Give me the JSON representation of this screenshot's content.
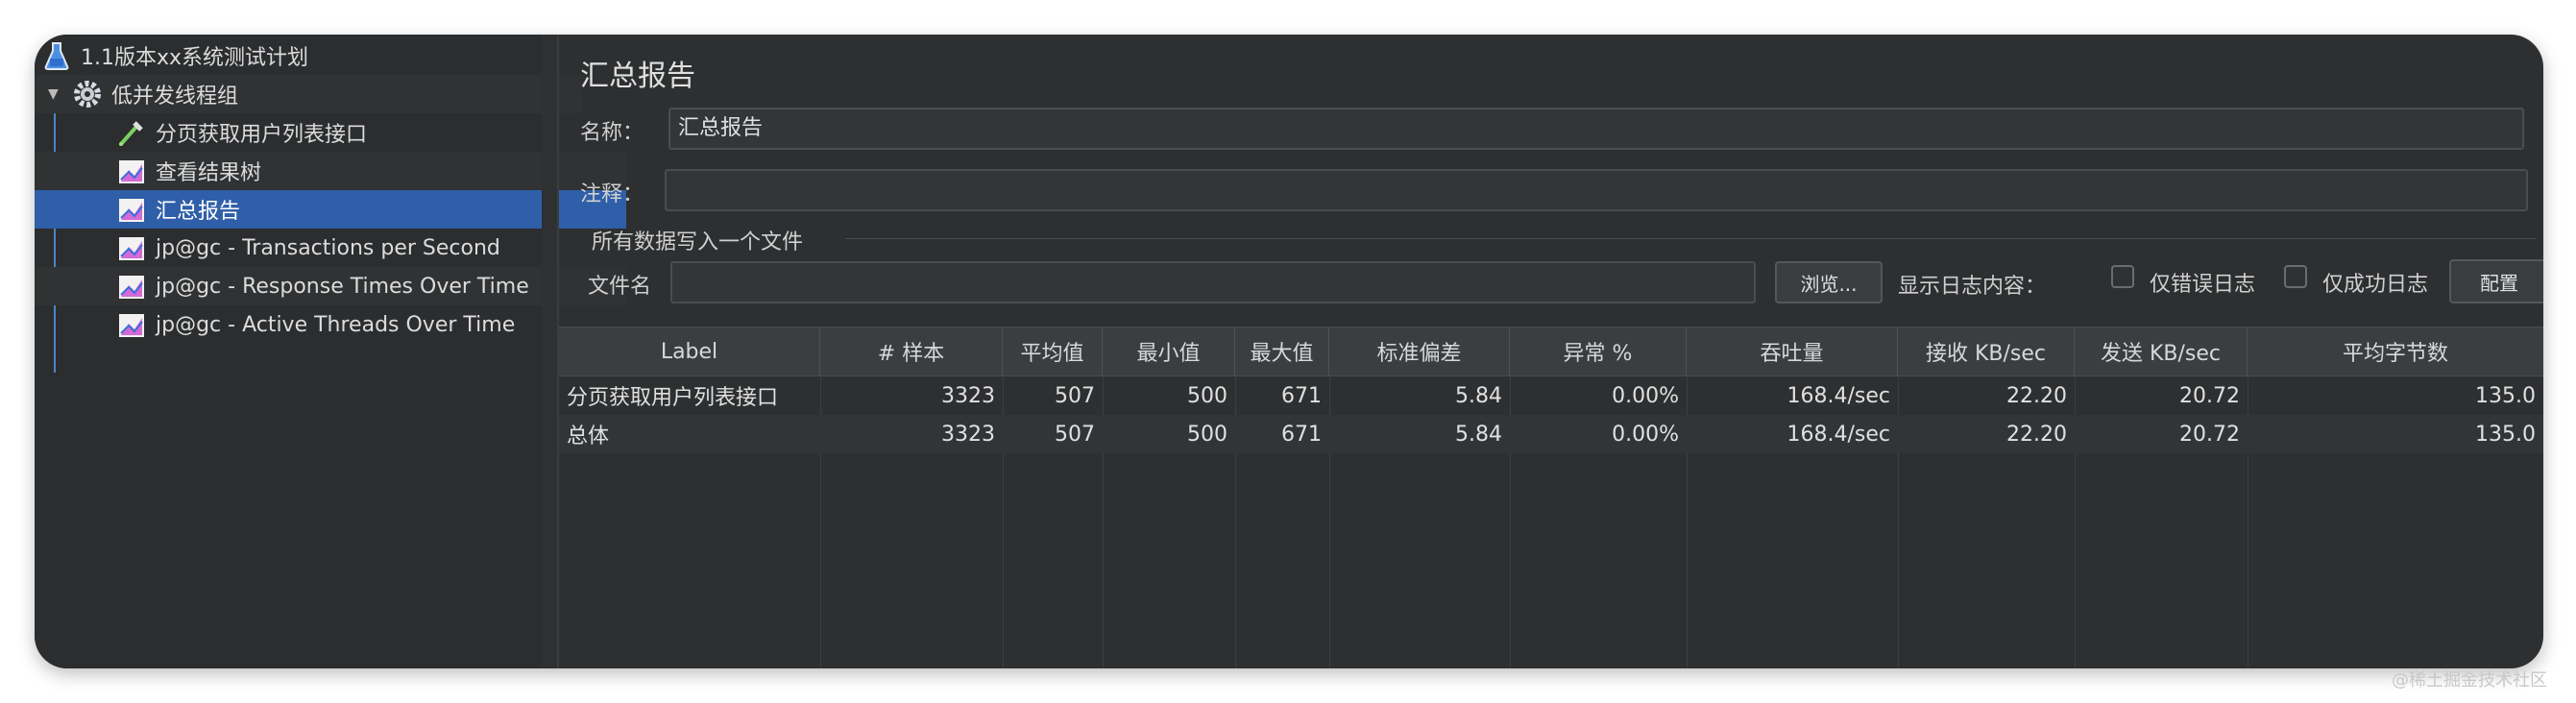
{
  "tree": {
    "items": [
      {
        "label": "1.1版本xx系统测试计划",
        "icon": "flask-icon"
      },
      {
        "label": "低并发线程组",
        "icon": "gear-icon"
      },
      {
        "label": "分页获取用户列表接口",
        "icon": "pipette-icon"
      },
      {
        "label": "查看结果树",
        "icon": "chart-icon"
      },
      {
        "label": "汇总报告",
        "icon": "chart-icon"
      },
      {
        "label": "jp@gc - Transactions per Second",
        "icon": "chart-icon"
      },
      {
        "label": "jp@gc - Response Times Over Time",
        "icon": "chart-icon"
      },
      {
        "label": "jp@gc - Active Threads Over Time",
        "icon": "chart-icon"
      }
    ]
  },
  "panel": {
    "title": "汇总报告",
    "name_label": "名称：",
    "name_value": "汇总报告",
    "comment_label": "注释：",
    "comment_value": "",
    "group_title": "所有数据写入一个文件",
    "filename_label": "文件名",
    "filename_value": "",
    "browse_label": "浏览...",
    "log_label": "显示日志内容：",
    "errors_only_label": "仅错误日志",
    "success_only_label": "仅成功日志",
    "config_label": "配置"
  },
  "table": {
    "columns": [
      "Label",
      "# 样本",
      "平均值",
      "最小值",
      "最大值",
      "标准偏差",
      "异常 %",
      "吞吐量",
      "接收 KB/sec",
      "发送 KB/sec",
      "平均字节数"
    ],
    "rows": [
      [
        "分页获取用户列表接口",
        "3323",
        "507",
        "500",
        "671",
        "5.84",
        "0.00%",
        "168.4/sec",
        "22.20",
        "20.72",
        "135.0"
      ],
      [
        "总体",
        "3323",
        "507",
        "500",
        "671",
        "5.84",
        "0.00%",
        "168.4/sec",
        "22.20",
        "20.72",
        "135.0"
      ]
    ]
  },
  "watermark": "@稀土掘金技术社区",
  "colors": {
    "selected": "#2f5fa8",
    "background": "#2d2f31",
    "tree_line": "#4a86c5"
  }
}
